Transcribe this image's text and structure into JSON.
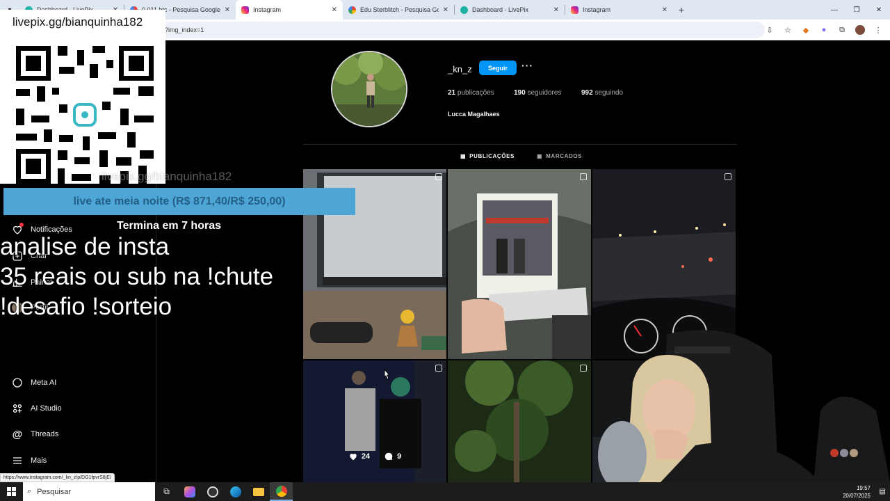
{
  "browser": {
    "tabs": [
      {
        "title": "Dashboard - LivePix",
        "icon": "livepix-icon",
        "active": false
      },
      {
        "title": "0,011 btc - Pesquisa Google",
        "icon": "google-icon",
        "active": false
      },
      {
        "title": "Instagram",
        "icon": "instagram-icon",
        "active": true
      },
      {
        "title": "Edu Sterblitch - Pesquisa Google",
        "icon": "google-icon",
        "active": false
      },
      {
        "title": "Dashboard - LivePix",
        "icon": "livepix-icon",
        "active": false
      },
      {
        "title": "Instagram",
        "icon": "instagram-icon",
        "active": false
      }
    ],
    "address_fragment": "?img_index=1",
    "status_url": "https://www.instagram.com/_kn_z/p/DG1fpvrS8jE/"
  },
  "sidebar": {
    "items": [
      {
        "label": "Notificações",
        "icon": "heart-icon"
      },
      {
        "label": "Criar",
        "icon": "plus-square-icon"
      },
      {
        "label": "Painel",
        "icon": "chart-icon"
      },
      {
        "label": "Perfil",
        "icon": "profile-icon"
      },
      {
        "label": "Meta AI",
        "icon": "meta-ai-icon"
      },
      {
        "label": "AI Studio",
        "icon": "ai-studio-icon"
      },
      {
        "label": "Threads",
        "icon": "threads-icon"
      },
      {
        "label": "Mais",
        "icon": "menu-icon"
      }
    ]
  },
  "profile": {
    "username": "_kn_z",
    "follow_label": "Seguir",
    "more_label": "···",
    "posts_count": "21",
    "posts_label": "publicações",
    "followers_count": "190",
    "followers_label": "seguidores",
    "following_count": "992",
    "following_label": "seguindo",
    "full_name": "Lucca Magalhaes",
    "tabs": [
      "PUBLICAÇÕES",
      "MARCADOS"
    ]
  },
  "hovered_post": {
    "likes": "24",
    "comments": "9"
  },
  "overlay": {
    "qr_title": "livepix.gg/bianquinha182",
    "ghost_link": "livepix.gg/bianquinha182",
    "goal": "live ate meia noite (R$ 871,40/R$ 250,00)",
    "goal_sub": "Termina em 7 horas",
    "promo_lines": [
      "analise de insta",
      "35 reais ou sub na !chute",
      "!desafio !sorteio"
    ]
  },
  "taskbar": {
    "search_placeholder": "Pesquisar",
    "time": "19:57",
    "date": "20/07/2025"
  },
  "colors": {
    "instagram_bg": "#000000",
    "follow_blue": "#0095f6",
    "goal_bar": "#4ea6d6"
  }
}
